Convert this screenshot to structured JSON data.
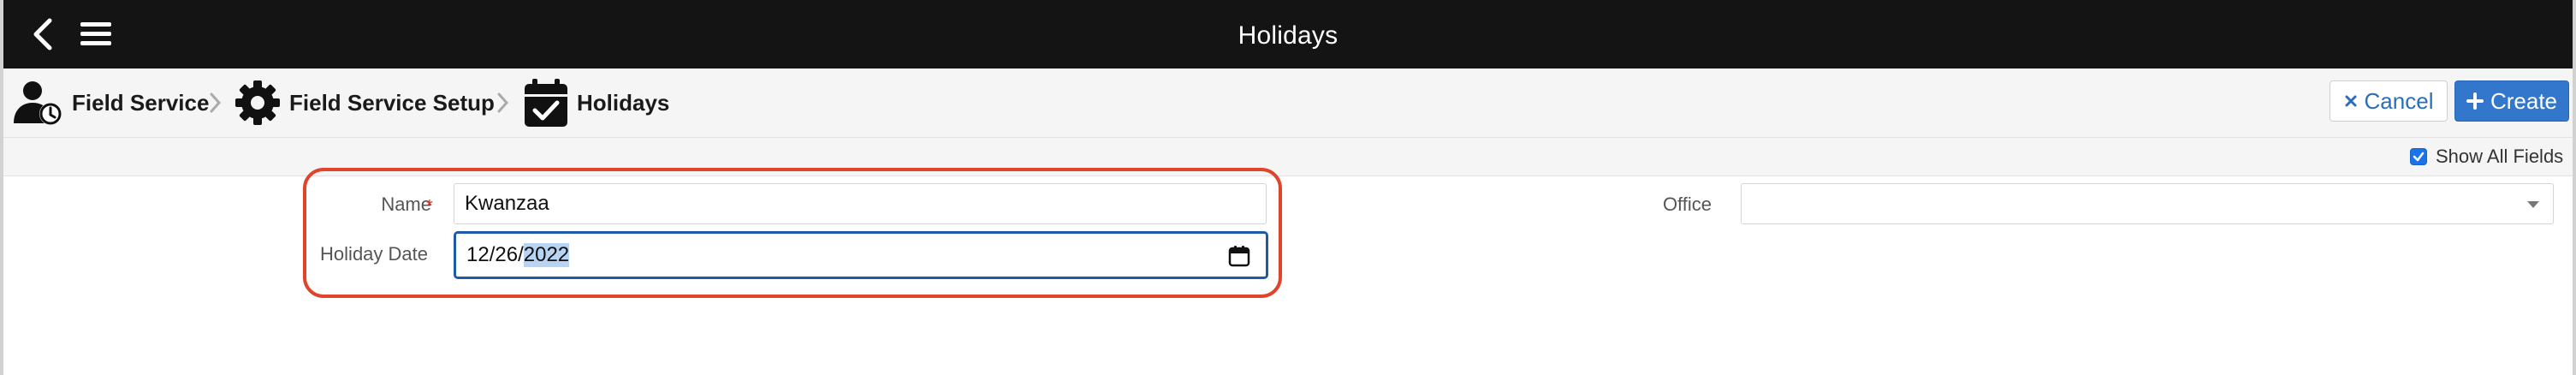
{
  "header": {
    "title": "Holidays"
  },
  "breadcrumb": [
    {
      "label": "Field Service",
      "icon": "user-clock-icon"
    },
    {
      "label": "Field Service Setup",
      "icon": "gear-icon"
    },
    {
      "label": "Holidays",
      "icon": "calendar-check-icon"
    }
  ],
  "actions": {
    "cancel_label": "Cancel",
    "create_label": "Create"
  },
  "toolbar": {
    "show_all_fields_label": "Show All Fields",
    "show_all_fields_checked": true
  },
  "form": {
    "name": {
      "label": "Name",
      "required_mark": "*",
      "value": "Kwanzaa"
    },
    "holiday_date": {
      "label": "Holiday Date",
      "month": "12",
      "day": "26",
      "year": "2022",
      "separator": "/"
    },
    "office": {
      "label": "Office",
      "value": ""
    }
  },
  "colors": {
    "topbar": "#141414",
    "accent_blue": "#3377cc",
    "annotation_red": "#e0452c",
    "required_red": "#d43a2a"
  }
}
